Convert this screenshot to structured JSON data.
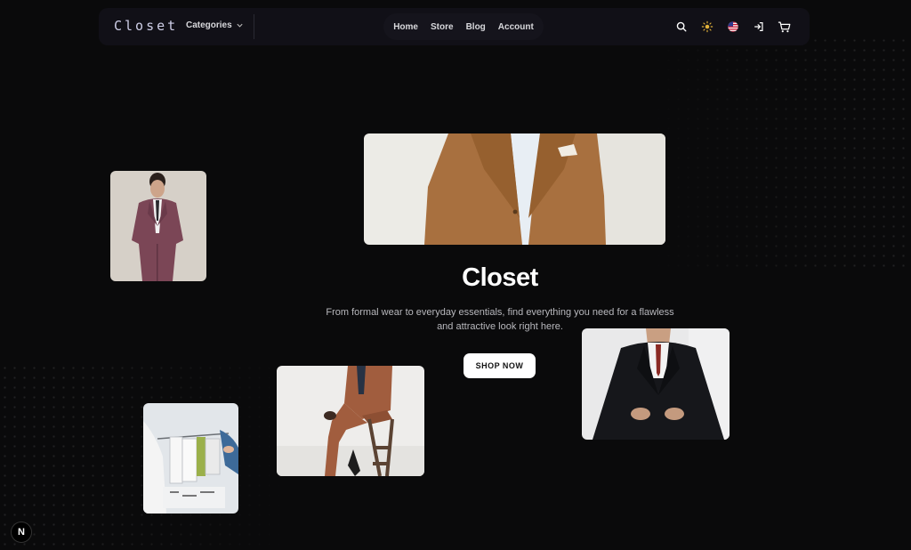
{
  "header": {
    "logo": "Closet",
    "categories_label": "Categories",
    "nav": [
      {
        "label": "Home"
      },
      {
        "label": "Store"
      },
      {
        "label": "Blog"
      },
      {
        "label": "Account"
      }
    ],
    "icons": [
      "search-icon",
      "sun-icon",
      "us-flag-icon",
      "login-icon",
      "cart-icon"
    ]
  },
  "hero": {
    "title": "Closet",
    "subtitle_line1": "From formal wear to everyday essentials, find everything you need for a flawless",
    "subtitle_line2": "and attractive look right here.",
    "cta": "SHOP NOW"
  },
  "badge": {
    "label": "N"
  },
  "colors": {
    "background": "#0a0a0b",
    "navbar": "#111017",
    "sun_accent": "#e2b23a",
    "button_bg": "#ffffff",
    "camel_suit": "#a8703f",
    "burgundy_suit": "#7b4656",
    "black_suit": "#16171b"
  }
}
